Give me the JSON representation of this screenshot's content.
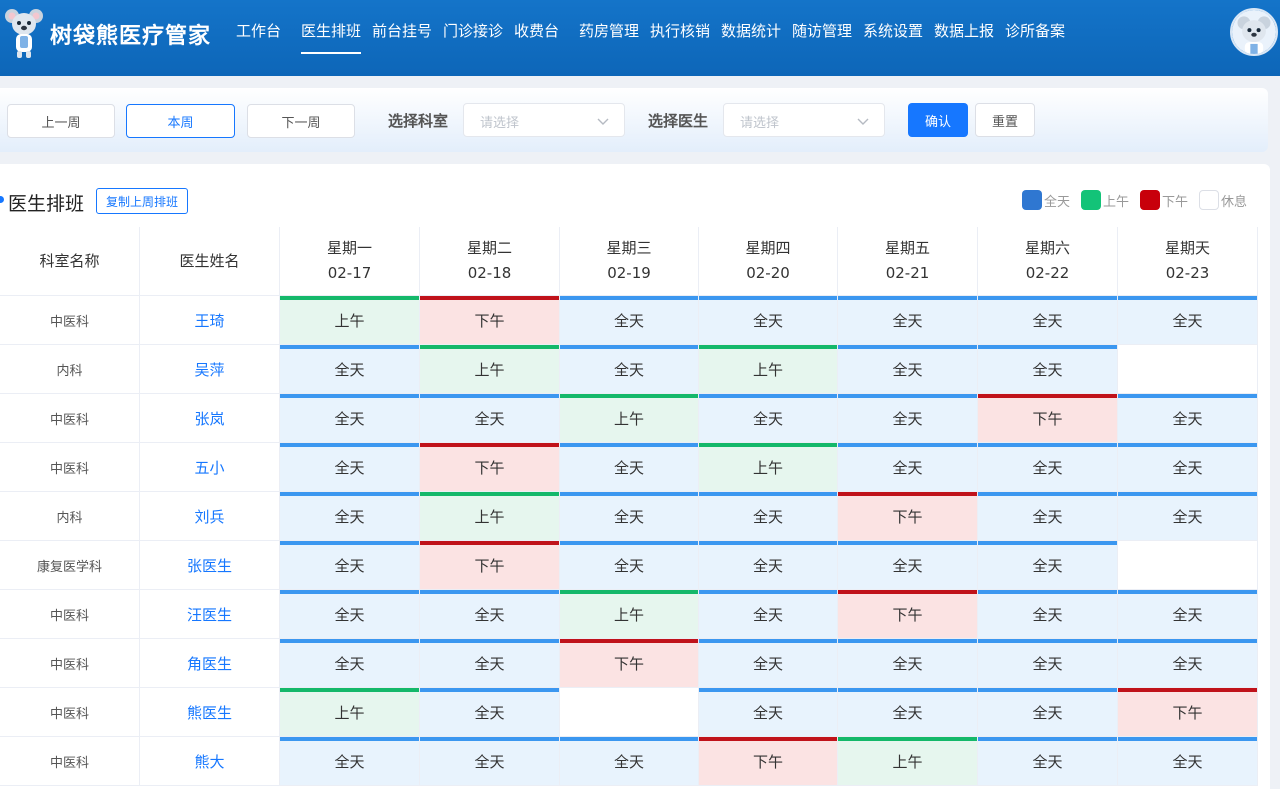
{
  "app": {
    "brand": "树袋熊医疗管家",
    "nav": [
      {
        "label": "工作台",
        "active": false
      },
      {
        "label": "医生排班",
        "active": true
      },
      {
        "label": "前台挂号",
        "active": false
      },
      {
        "label": "门诊接诊",
        "active": false
      },
      {
        "label": "收费台",
        "active": false
      },
      {
        "label": "药房管理",
        "active": false
      },
      {
        "label": "执行核销",
        "active": false
      },
      {
        "label": "数据统计",
        "active": false
      },
      {
        "label": "随访管理",
        "active": false
      },
      {
        "label": "系统设置",
        "active": false
      },
      {
        "label": "数据上报",
        "active": false
      },
      {
        "label": "诊所备案",
        "active": false
      }
    ]
  },
  "toolbar": {
    "prev_week": "上一周",
    "this_week": "本周",
    "next_week": "下一周",
    "dept_label": "选择科室",
    "dept_placeholder": "请选择",
    "doctor_label": "选择医生",
    "doctor_placeholder": "请选择",
    "confirm": "确认",
    "reset": "重置"
  },
  "schedule": {
    "title": "医生排班",
    "copy_button": "复制上周排班",
    "legend": [
      {
        "key": "full",
        "label": "全天"
      },
      {
        "key": "am",
        "label": "上午"
      },
      {
        "key": "pm",
        "label": "下午"
      },
      {
        "key": "rest",
        "label": "休息"
      }
    ],
    "shift_labels": {
      "full": "全天",
      "am": "上午",
      "pm": "下午",
      "rest": ""
    },
    "columns": {
      "dept": "科室名称",
      "doctor": "医生姓名"
    },
    "days": [
      {
        "weekday": "星期一",
        "date": "02-17"
      },
      {
        "weekday": "星期二",
        "date": "02-18"
      },
      {
        "weekday": "星期三",
        "date": "02-19"
      },
      {
        "weekday": "星期四",
        "date": "02-20"
      },
      {
        "weekday": "星期五",
        "date": "02-21"
      },
      {
        "weekday": "星期六",
        "date": "02-22"
      },
      {
        "weekday": "星期天",
        "date": "02-23"
      }
    ],
    "rows": [
      {
        "dept": "中医科",
        "doctor": "王琦",
        "shifts": [
          "am",
          "pm",
          "full",
          "full",
          "full",
          "full",
          "full"
        ]
      },
      {
        "dept": "内科",
        "doctor": "吴萍",
        "shifts": [
          "full",
          "am",
          "full",
          "am",
          "full",
          "full",
          "rest"
        ]
      },
      {
        "dept": "中医科",
        "doctor": "张岚",
        "shifts": [
          "full",
          "full",
          "am",
          "full",
          "full",
          "pm",
          "full"
        ]
      },
      {
        "dept": "中医科",
        "doctor": "五小",
        "shifts": [
          "full",
          "pm",
          "full",
          "am",
          "full",
          "full",
          "full"
        ]
      },
      {
        "dept": "内科",
        "doctor": "刘兵",
        "shifts": [
          "full",
          "am",
          "full",
          "full",
          "pm",
          "full",
          "full"
        ]
      },
      {
        "dept": "康复医学科",
        "doctor": "张医生",
        "shifts": [
          "full",
          "pm",
          "full",
          "full",
          "full",
          "full",
          "rest"
        ]
      },
      {
        "dept": "中医科",
        "doctor": "汪医生",
        "shifts": [
          "full",
          "full",
          "am",
          "full",
          "pm",
          "full",
          "full"
        ]
      },
      {
        "dept": "中医科",
        "doctor": "角医生",
        "shifts": [
          "full",
          "full",
          "pm",
          "full",
          "full",
          "full",
          "full"
        ]
      },
      {
        "dept": "中医科",
        "doctor": "熊医生",
        "shifts": [
          "am",
          "full",
          "rest",
          "full",
          "full",
          "full",
          "pm"
        ]
      },
      {
        "dept": "中医科",
        "doctor": "熊大",
        "shifts": [
          "full",
          "full",
          "full",
          "pm",
          "am",
          "full",
          "full"
        ]
      }
    ]
  },
  "colors": {
    "primary": "#1677ff",
    "header_bg": "#0d66b8",
    "full_bar": "#3b97f0",
    "full_bg": "#e8f3fd",
    "am_bar": "#14b86a",
    "am_bg": "#e6f6ee",
    "pm_bar": "#c0121a",
    "pm_bg": "#fbe3e3",
    "legend_full": "#2f77d1",
    "legend_am": "#13c378",
    "legend_pm": "#c8000b"
  }
}
